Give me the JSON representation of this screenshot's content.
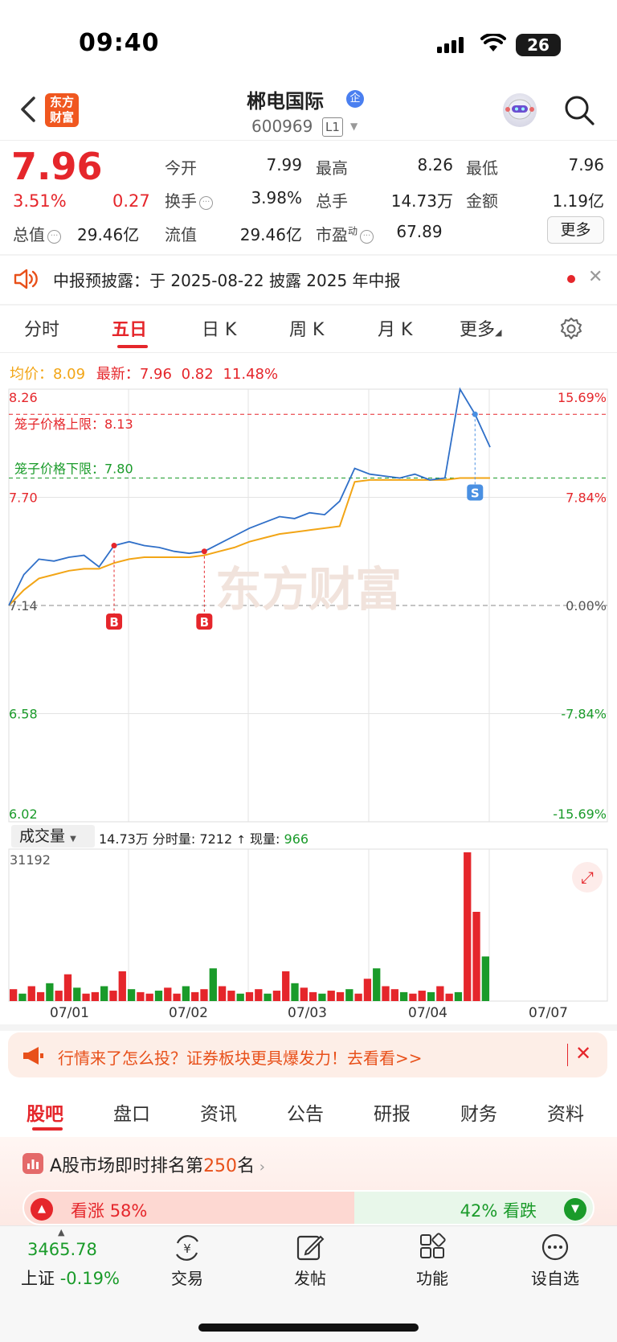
{
  "status_bar": {
    "time": "09:40",
    "battery": "26"
  },
  "header": {
    "logo_line1": "东方",
    "logo_line2": "财富",
    "stock_name": "郴电国际",
    "badge": "企",
    "stock_code": "600969",
    "level": "L1"
  },
  "quote": {
    "price": "7.96",
    "change_pct": "3.51%",
    "change": "0.27",
    "fields": [
      {
        "label": "今开",
        "value": "7.99"
      },
      {
        "label": "最高",
        "value": "8.26"
      },
      {
        "label": "最低",
        "value": "7.96"
      },
      {
        "label": "换手",
        "value": "3.98%"
      },
      {
        "label": "总手",
        "value": "14.73万"
      },
      {
        "label": "金额",
        "value": "1.19亿"
      },
      {
        "label": "总值",
        "value": "29.46亿"
      },
      {
        "label": "流值",
        "value": "29.46亿"
      },
      {
        "label": "市盈",
        "label_sup": "动",
        "value": "67.89"
      }
    ],
    "more_label": "更多"
  },
  "notice": {
    "text": "中报预披露：于 2025-08-22 披露 2025 年中报"
  },
  "chart_tabs": [
    "分时",
    "五日",
    "日 K",
    "周 K",
    "月 K",
    "更多"
  ],
  "chart_header": {
    "avg_label": "均价：",
    "avg_value": "8.09",
    "latest_label": "最新：",
    "latest_value": "7.96",
    "latest_change": "0.82",
    "latest_pct": "11.48%"
  },
  "chart_data": {
    "type": "line",
    "x_dates": [
      "07/01",
      "07/02",
      "07/03",
      "07/04",
      "07/07"
    ],
    "y_labels_left": [
      "8.26",
      "7.70",
      "7.14",
      "6.58",
      "6.02"
    ],
    "y_labels_right": [
      "15.69%",
      "7.84%",
      "0.00%",
      "-7.84%",
      "-15.69%"
    ],
    "ylim": [
      6.02,
      8.26
    ],
    "prev_close": 7.14,
    "upper_limit_label": "笼子价格上限：8.13",
    "upper_limit": 8.13,
    "lower_limit_label": "笼子价格下限：7.80",
    "lower_limit": 7.8,
    "price_series": [
      7.14,
      7.3,
      7.38,
      7.37,
      7.39,
      7.4,
      7.34,
      7.45,
      7.47,
      7.45,
      7.44,
      7.42,
      7.41,
      7.42,
      7.46,
      7.5,
      7.54,
      7.57,
      7.6,
      7.59,
      7.62,
      7.61,
      7.68,
      7.85,
      7.82,
      7.81,
      7.8,
      7.82,
      7.79,
      7.8,
      8.26,
      8.13,
      7.96
    ],
    "avg_series": [
      7.14,
      7.22,
      7.28,
      7.3,
      7.32,
      7.33,
      7.33,
      7.36,
      7.38,
      7.39,
      7.39,
      7.39,
      7.39,
      7.4,
      7.42,
      7.44,
      7.47,
      7.49,
      7.51,
      7.52,
      7.53,
      7.54,
      7.55,
      7.78,
      7.79,
      7.79,
      7.79,
      7.79,
      7.79,
      7.79,
      7.8,
      7.8,
      7.8
    ],
    "markers": [
      {
        "label": "B",
        "index": 7
      },
      {
        "label": "B",
        "index": 13
      },
      {
        "label": "S",
        "index": 31
      }
    ],
    "watermark": "东方财富"
  },
  "volume_chart": {
    "selector": "成交量",
    "summary_total": "14.73万",
    "summary_label1": "分时量:",
    "summary_val1": "7212",
    "summary_label2": "现量:",
    "summary_val2": "966",
    "max_label": "31192",
    "values": [
      0.08,
      0.05,
      0.1,
      0.06,
      0.12,
      0.07,
      0.18,
      0.09,
      0.05,
      0.06,
      0.1,
      0.07,
      0.2,
      0.08,
      0.06,
      0.05,
      0.07,
      0.09,
      0.05,
      0.1,
      0.06,
      0.08,
      0.22,
      0.1,
      0.07,
      0.05,
      0.06,
      0.08,
      0.05,
      0.07,
      0.2,
      0.12,
      0.09,
      0.06,
      0.05,
      0.07,
      0.06,
      0.08,
      0.05,
      0.15,
      0.22,
      0.1,
      0.08,
      0.06,
      0.05,
      0.07,
      0.06,
      0.1,
      0.05,
      0.06,
      1.0,
      0.6,
      0.3
    ]
  },
  "promo": {
    "text": "行情来了怎么投？证券板块更具爆发力！去看看>>"
  },
  "bottom_tabs": [
    "股吧",
    "盘口",
    "资讯",
    "公告",
    "研报",
    "财务",
    "资料"
  ],
  "rank": {
    "prefix": "A股市场即时排名第",
    "number": "250",
    "suffix": "名"
  },
  "vote": {
    "up_label": "看涨",
    "up_pct": "58%",
    "down_pct": "42%",
    "down_label": "看跌",
    "up_fraction": 0.58
  },
  "bottom_nav": {
    "index_value": "3465.78",
    "index_name": "上证",
    "index_change": "-0.19%",
    "items": [
      "交易",
      "发帖",
      "功能",
      "设自选"
    ]
  },
  "colors": {
    "up": "#e5262b",
    "down": "#1a9b2a",
    "accent": "#f0571f",
    "line": "#2f6fc8",
    "avg": "#f2a516"
  }
}
